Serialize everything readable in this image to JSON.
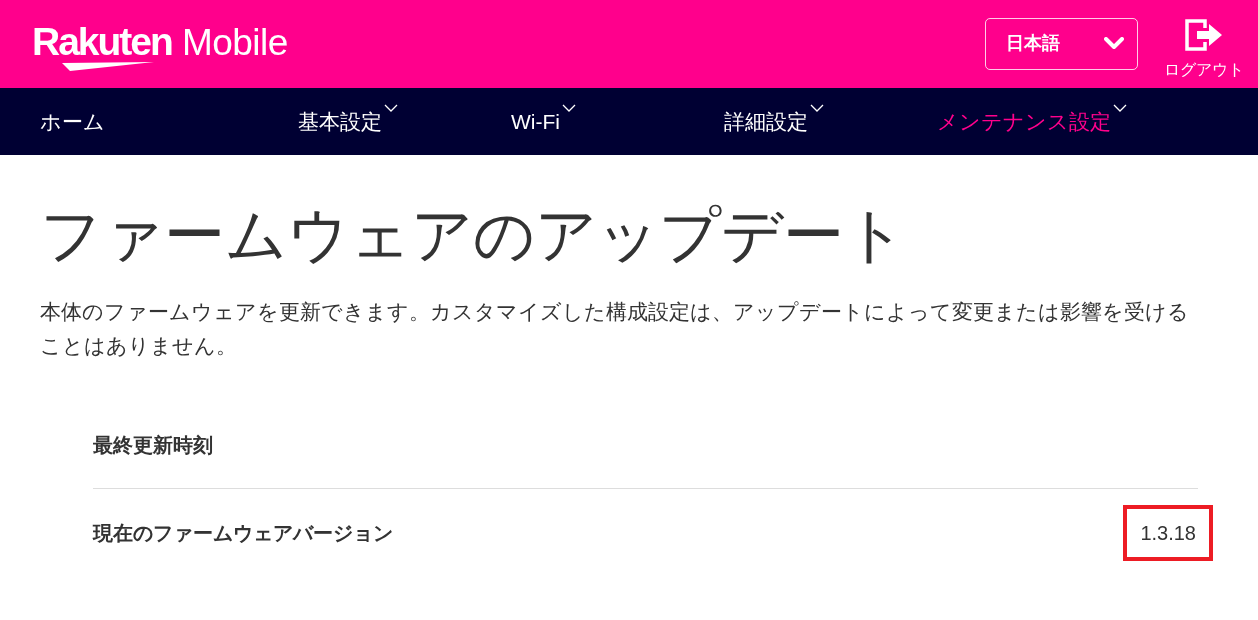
{
  "header": {
    "logo": {
      "brand": "Rakuten",
      "product": "Mobile"
    },
    "language_select": {
      "value": "日本語"
    },
    "logout": {
      "label": "ログアウト"
    }
  },
  "nav": [
    {
      "label": "ホーム",
      "has_menu": false,
      "selected": false
    },
    {
      "label": "基本設定",
      "has_menu": true,
      "selected": false
    },
    {
      "label": "Wi-Fi",
      "has_menu": true,
      "selected": false
    },
    {
      "label": "詳細設定",
      "has_menu": true,
      "selected": false
    },
    {
      "label": "メンテナンス設定",
      "has_menu": true,
      "selected": true
    }
  ],
  "page": {
    "title": "ファームウェアのアップデート",
    "description": "本体のファームウェアを更新できます。カスタマイズした構成設定は、アップデートによって変更または影響を受けることはありません。"
  },
  "info_rows": [
    {
      "label": "最終更新時刻"
    },
    {
      "label": "現在のファームウェアバージョン",
      "value": "1.3.18",
      "highlighted": true
    }
  ]
}
